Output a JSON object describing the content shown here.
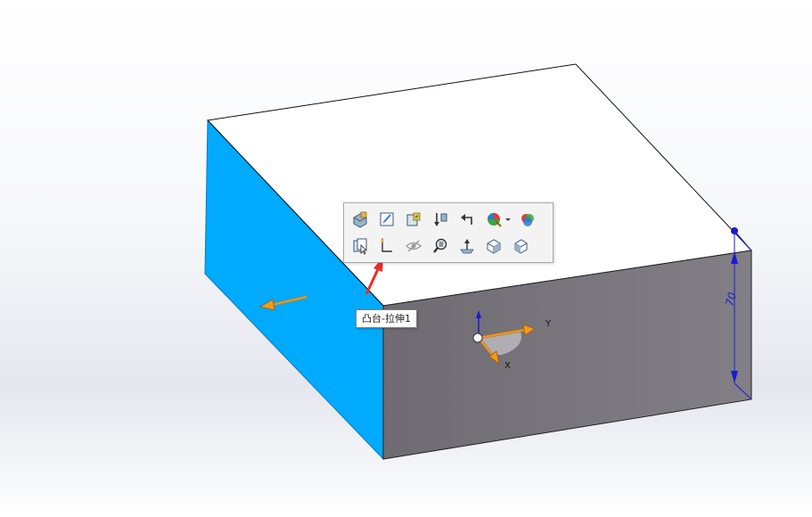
{
  "tooltip": {
    "text": "凸台-拉伸1"
  },
  "triad": {
    "y_label": "Y",
    "x_label": "X"
  },
  "dimension": {
    "value": "70"
  },
  "colors": {
    "top_face": "#ffffff",
    "side_face_selected": "#00aaff",
    "front_face": "#7d7a7f",
    "dimension": "#1a1ad4",
    "arrow": "#f29a1c",
    "pointer_arrow": "#e8302a"
  },
  "toolbar": {
    "row1": [
      "edit-feature-icon",
      "edit-sketch-icon",
      "hide-icon",
      "rollback-icon",
      "parent-child-icon",
      "appearance-icon",
      "dropdown-arrow-icon",
      "color-icon"
    ],
    "row2": [
      "select-other-icon",
      "sketch-icon",
      "hide-show-icon",
      "zoom-to-selection-icon",
      "normal-to-icon",
      "view-orientation-icon",
      "isometric-icon"
    ]
  }
}
